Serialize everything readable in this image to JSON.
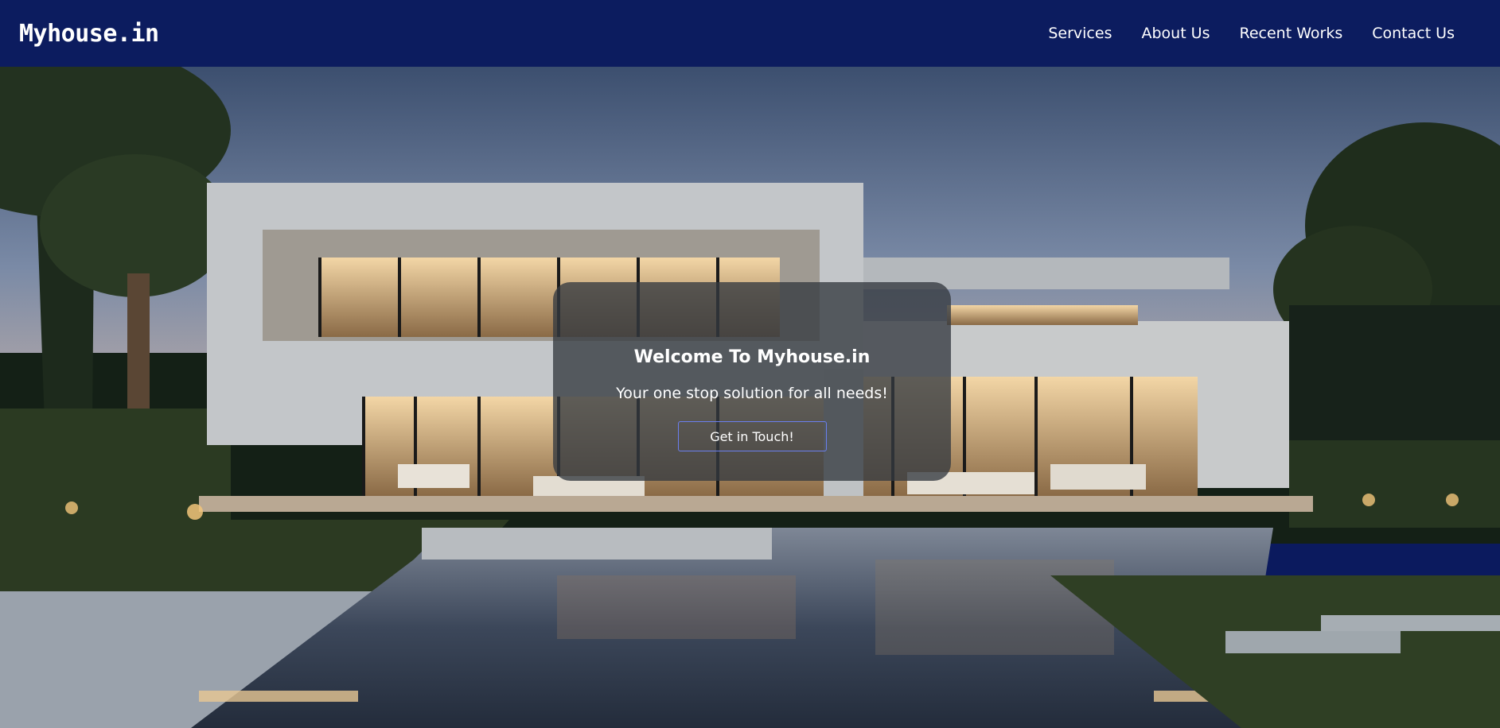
{
  "nav": {
    "brand": "Myhouse.in",
    "links": [
      "Services",
      "About Us",
      "Recent Works",
      "Contact Us"
    ]
  },
  "hero": {
    "title": "Welcome To Myhouse.in",
    "subtitle": "Your one stop solution for all needs!",
    "cta_label": "Get in Touch!"
  },
  "colors": {
    "navbar": "#0c1c5f",
    "card_bg": "#343a40",
    "cta_border": "#6b7ff0"
  }
}
